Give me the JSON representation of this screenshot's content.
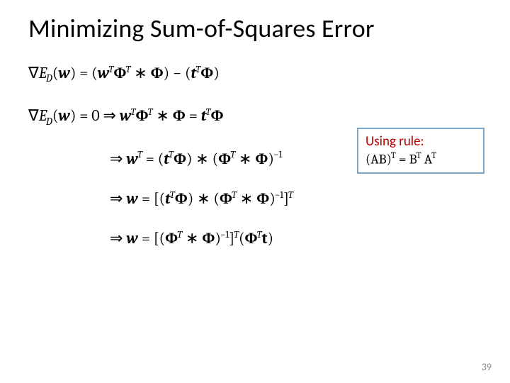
{
  "title": "Minimizing Sum-of-Squares Error",
  "eqs": {
    "e1": "∇",
    "e1_2": "E",
    "e1_sub": "D",
    "e1_3": "(",
    "e1_4": "w",
    "e1_5": ") = (",
    "e1_6": "w",
    "e1_sup1": "T",
    "e1_7": "Φ",
    "e1_sup2": "T",
    "e1_8": " ∗ ",
    "e1_9": "Φ",
    "e1_10": ") − (",
    "e1_11": "t",
    "e1_sup3": " T",
    "e1_12": "Φ",
    "e1_13": ")",
    "e2": "∇",
    "e2_2": "E",
    "e2_sub": "D",
    "e2_3": "(",
    "e2_4": "w",
    "e2_5": ") = 0 ⇒ ",
    "e2_6": "w",
    "e2_sup1": "T",
    "e2_7": "Φ",
    "e2_sup2": "T",
    "e2_8": " ∗ ",
    "e2_9": "Φ",
    "e2_10": " = ",
    "e2_11": "t",
    "e2_sup3": " T",
    "e2_12": "Φ",
    "e3_a": "⇒ ",
    "e3_1": "w",
    "e3_sup1": "T",
    "e3_2": " = (",
    "e3_3": "t",
    "e3_sup2": " T",
    "e3_4": "Φ",
    "e3_5": ") ∗ (",
    "e3_6": "Φ",
    "e3_sup3": "T",
    "e3_7": " ∗ ",
    "e3_8": "Φ",
    "e3_9": ")",
    "e3_sup4": "−1",
    "e4_a": "⇒ ",
    "e4_1": "w",
    "e4_2": " = [(",
    "e4_3": "t",
    "e4_sup1": " T",
    "e4_4": "Φ",
    "e4_5": ") ∗ (",
    "e4_6": "Φ",
    "e4_sup2": "T",
    "e4_7": " ∗ ",
    "e4_8": "Φ",
    "e4_9": ")",
    "e4_sup3": "−1",
    "e4_10": "]",
    "e4_sup4": "T",
    "e5_a": "⇒ ",
    "e5_1": "w",
    "e5_2": " = [(",
    "e5_3": "Φ",
    "e5_sup1": "T",
    "e5_4": " ∗ ",
    "e5_5": "Φ",
    "e5_6": ")",
    "e5_sup2": "−1",
    "e5_7": "]",
    "e5_sup3": "T",
    "e5_8": "(",
    "e5_9": "Φ",
    "e5_sup4": "T",
    "e5_10": "t",
    "e5_11": ")"
  },
  "aside": {
    "label": "Using rule:",
    "rule_1": "(",
    "rule_2": "AB",
    "rule_3": ")",
    "rule_sup1": "T",
    "rule_4": " = ",
    "rule_5": "B",
    "rule_sup2": "T",
    "rule_6": " ",
    "rule_7": "A",
    "rule_sup3": "T"
  },
  "page_number": "39"
}
